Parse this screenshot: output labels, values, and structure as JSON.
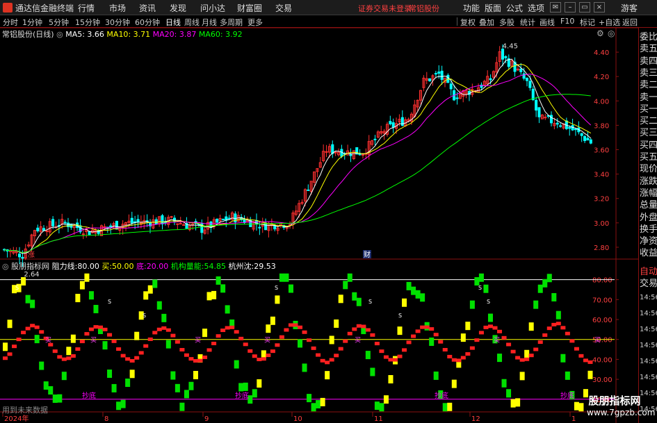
{
  "app": {
    "title": "通达信金融终端",
    "menu": [
      "行情",
      "市场",
      "资讯",
      "发现",
      "问小达",
      "财富圈",
      "交易"
    ],
    "notice": "证券交易未登录",
    "stock_name_top": "常铝股份",
    "right_menu": [
      "功能",
      "版面",
      "公式",
      "选项"
    ],
    "guest": "游客"
  },
  "toolbar": {
    "periods": [
      "分时",
      "1分钟",
      "5分钟",
      "15分钟",
      "30分钟",
      "60分钟",
      "日线",
      "周线",
      "月线",
      "多周期",
      "更多"
    ],
    "active_period": "日线",
    "tools": [
      "复权",
      "叠加",
      "多股",
      "统计",
      "画线",
      "F10",
      "标记",
      "+自选",
      "返回"
    ]
  },
  "main_chart": {
    "stock_label": "常铝股份(日线)",
    "ma": [
      {
        "name": "MA5",
        "value": "3.66",
        "color": "#ffffff"
      },
      {
        "name": "MA10",
        "value": "3.71",
        "color": "#ffff00"
      },
      {
        "name": "MA20",
        "value": "3.87",
        "color": "#ff00ff"
      },
      {
        "name": "MA60",
        "value": "3.92",
        "color": "#00ff00"
      }
    ],
    "high_label": "4.45",
    "low_label": "2.64",
    "marker_zhang": "涨",
    "marker_cai": "财"
  },
  "indicator": {
    "name": "股朋指标网",
    "params": [
      {
        "label": "阻力线:",
        "value": "80.00",
        "color": "#ffffff"
      },
      {
        "label": "买:",
        "value": "50.00",
        "color": "#ffff00"
      },
      {
        "label": "底:",
        "value": "20.00",
        "color": "#ff00ff"
      },
      {
        "label": "机构量能:",
        "value": "54.85",
        "color": "#00ff00"
      },
      {
        "label": "杭州沈:",
        "value": "29.53",
        "color": "#ffffff"
      }
    ],
    "chaodi_label": "抄底",
    "mai_label": "买",
    "s_label": "S",
    "footer_note": "用到未来数据"
  },
  "right_panel": {
    "labels": [
      "委比",
      "卖五",
      "卖四",
      "卖三",
      "卖二",
      "卖一",
      "买一",
      "买二",
      "买三",
      "买四",
      "买五",
      "现价",
      "涨跌",
      "涨幅",
      "总量",
      "外盘",
      "换手",
      "净资",
      "收益"
    ],
    "bottom_labels": [
      "自动",
      "交易"
    ],
    "times": [
      "14:56",
      "14:56",
      "14:56",
      "14:56",
      "14:56",
      "14:56",
      "14:56",
      "14:56"
    ]
  },
  "watermark": {
    "text": "股朋指标网",
    "url": "www.7gpzb.com"
  },
  "chart_data": [
    {
      "type": "candlestick",
      "y_ticks": [
        "4.40",
        "4.20",
        "4.00",
        "3.80",
        "3.60",
        "3.40",
        "3.20",
        "3.00",
        "2.80"
      ],
      "ylim": [
        2.72,
        4.52
      ],
      "x_ticks": [
        "2024年",
        "8",
        "9",
        "10",
        "11",
        "12",
        "1"
      ],
      "series": [
        {
          "name": "MA5",
          "color": "#ffffff"
        },
        {
          "name": "MA10",
          "color": "#ffff00"
        },
        {
          "name": "MA20",
          "color": "#ff00ff"
        },
        {
          "name": "MA60",
          "color": "#00ff00"
        }
      ],
      "close_start": 2.78,
      "close_end": 3.66,
      "high": 4.45,
      "low": 2.64
    },
    {
      "type": "line",
      "y_ticks": [
        "80.00",
        "70.00",
        "60.00",
        "50.00",
        "40.00",
        "30.00",
        "20.00"
      ],
      "ylim": [
        14,
        83
      ],
      "reference_lines": [
        {
          "name": "阻力线",
          "value": 80,
          "color": "#ffffff"
        },
        {
          "name": "买",
          "value": 50,
          "color": "#ffff00"
        },
        {
          "name": "底",
          "value": 20,
          "color": "#ff00ff"
        }
      ],
      "series": [
        {
          "name": "机构量能",
          "color": "#00ff00",
          "last": 54.85
        },
        {
          "name": "杭州沈",
          "color": "#ff2020",
          "last": 29.53
        }
      ]
    }
  ]
}
